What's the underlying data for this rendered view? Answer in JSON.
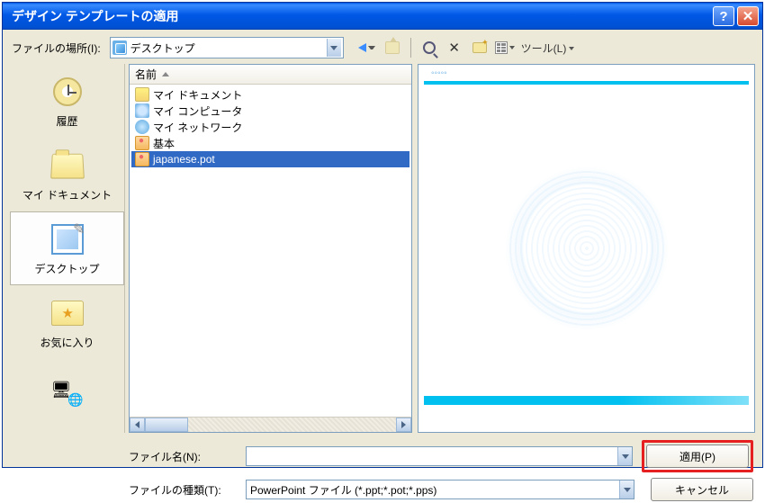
{
  "title": "デザイン テンプレートの適用",
  "lookin_label": "ファイルの場所(I):",
  "lookin_value": "デスクトップ",
  "toolbar": {
    "tools_label": "ツール(L)"
  },
  "places": [
    {
      "label": "履歴",
      "icon": "history"
    },
    {
      "label": "マイ ドキュメント",
      "icon": "mydocs"
    },
    {
      "label": "デスクトップ",
      "icon": "desktop",
      "selected": true
    },
    {
      "label": "お気に入り",
      "icon": "fav"
    },
    {
      "label": "",
      "icon": "netplaces"
    }
  ],
  "list": {
    "header": "名前",
    "items": [
      {
        "label": "マイ ドキュメント",
        "icon": "folder"
      },
      {
        "label": "マイ コンピュータ",
        "icon": "mycomp"
      },
      {
        "label": "マイ ネットワーク",
        "icon": "netp"
      },
      {
        "label": "基本",
        "icon": "tmpl"
      },
      {
        "label": "japanese.pot",
        "icon": "tmpl",
        "selected": true
      }
    ]
  },
  "filename_label": "ファイル名(N):",
  "filename_value": "",
  "filetype_label": "ファイルの種類(T):",
  "filetype_value": "PowerPoint ファイル (*.ppt;*.pot;*.pps)",
  "apply_label": "適用(P)",
  "cancel_label": "キャンセル"
}
